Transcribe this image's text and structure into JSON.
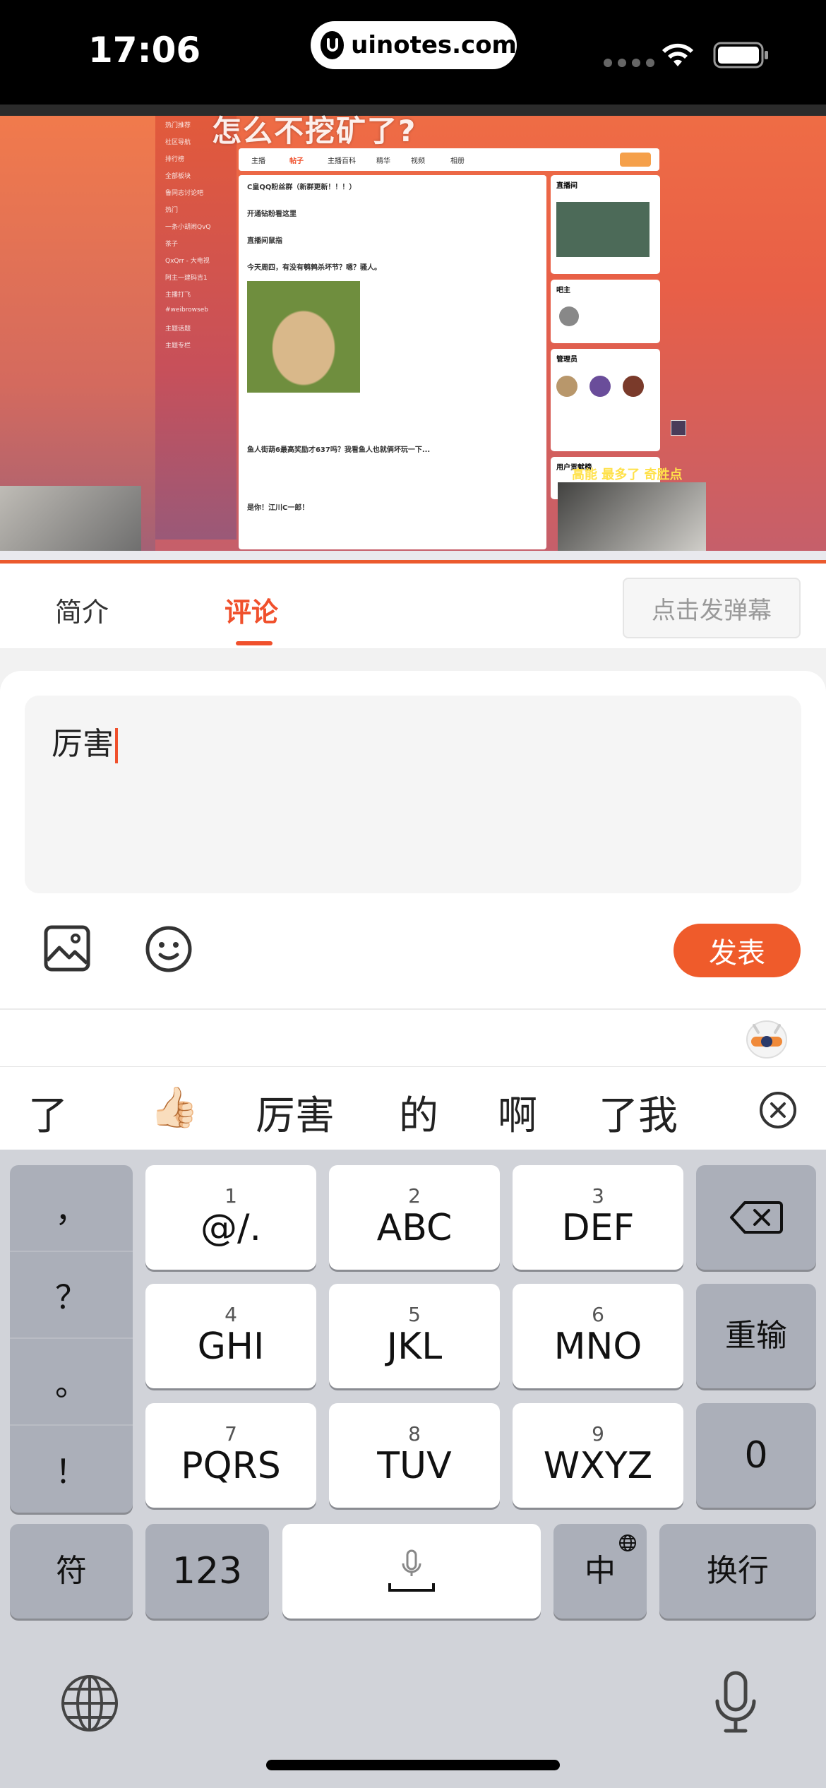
{
  "status_bar": {
    "time": "17:06",
    "url": "uinotes.com"
  },
  "video": {
    "overlay_title": "怎么不挖矿了?",
    "site_tabs": [
      "主播",
      "帖子",
      "主播百科",
      "精华",
      "视频",
      "相册"
    ],
    "posts": [
      "C皇QQ粉丝群（新群更新！！！）",
      "开通钻粉看这里",
      "直播间鼠指",
      "今天周四，有没有鹌鹑杀坏节？嗯？骚人。",
      "鱼人街葫6最高奖励才637吗？我看鱼人也就俩坏玩一下...",
      "是你！江川C一郎！"
    ],
    "right_panel": [
      "直播间",
      "吧主",
      "管理员",
      "用户贡献榜"
    ],
    "sidebar_items": [
      "热门推荐",
      "社区导航",
      "排行榜",
      "全部板块",
      "鲁同志讨论吧",
      "热门",
      "一条小胡闹QvQ",
      "茶子",
      "QxQrr - 大电视",
      "阿主一建码吉1",
      "主播打飞",
      "#weibrowseb",
      "主题话题",
      "主题专栏"
    ],
    "danmaku_overlay": "高能 最多了 奇胜点"
  },
  "tabs": {
    "intro": "简介",
    "comments": "评论",
    "danmaku_button": "点击发弹幕"
  },
  "comment_box": {
    "text": "厉害",
    "post_button": "发表"
  },
  "candidates": [
    "了",
    "👍🏻",
    "厉害",
    "的",
    "啊",
    "了我"
  ],
  "keyboard": {
    "punct": [
      "，",
      "？",
      "。",
      "！"
    ],
    "rows": [
      [
        {
          "num": "1",
          "label": "@/."
        },
        {
          "num": "2",
          "label": "ABC"
        },
        {
          "num": "3",
          "label": "DEF"
        }
      ],
      [
        {
          "num": "4",
          "label": "GHI"
        },
        {
          "num": "5",
          "label": "JKL"
        },
        {
          "num": "6",
          "label": "MNO"
        }
      ],
      [
        {
          "num": "7",
          "label": "PQRS"
        },
        {
          "num": "8",
          "label": "TUV"
        },
        {
          "num": "9",
          "label": "WXYZ"
        }
      ]
    ],
    "retype": "重输",
    "zero": "0",
    "symbols": "符",
    "numbers": "123",
    "lang": "中",
    "enter": "换行"
  },
  "colors": {
    "accent": "#ef5b2b",
    "keyboard_bg": "#d1d3d9"
  },
  "icons": [
    "wifi-icon",
    "battery-icon",
    "image-icon",
    "emoji-icon",
    "delete-icon",
    "globe-icon",
    "microphone-icon",
    "close-circle-icon"
  ]
}
